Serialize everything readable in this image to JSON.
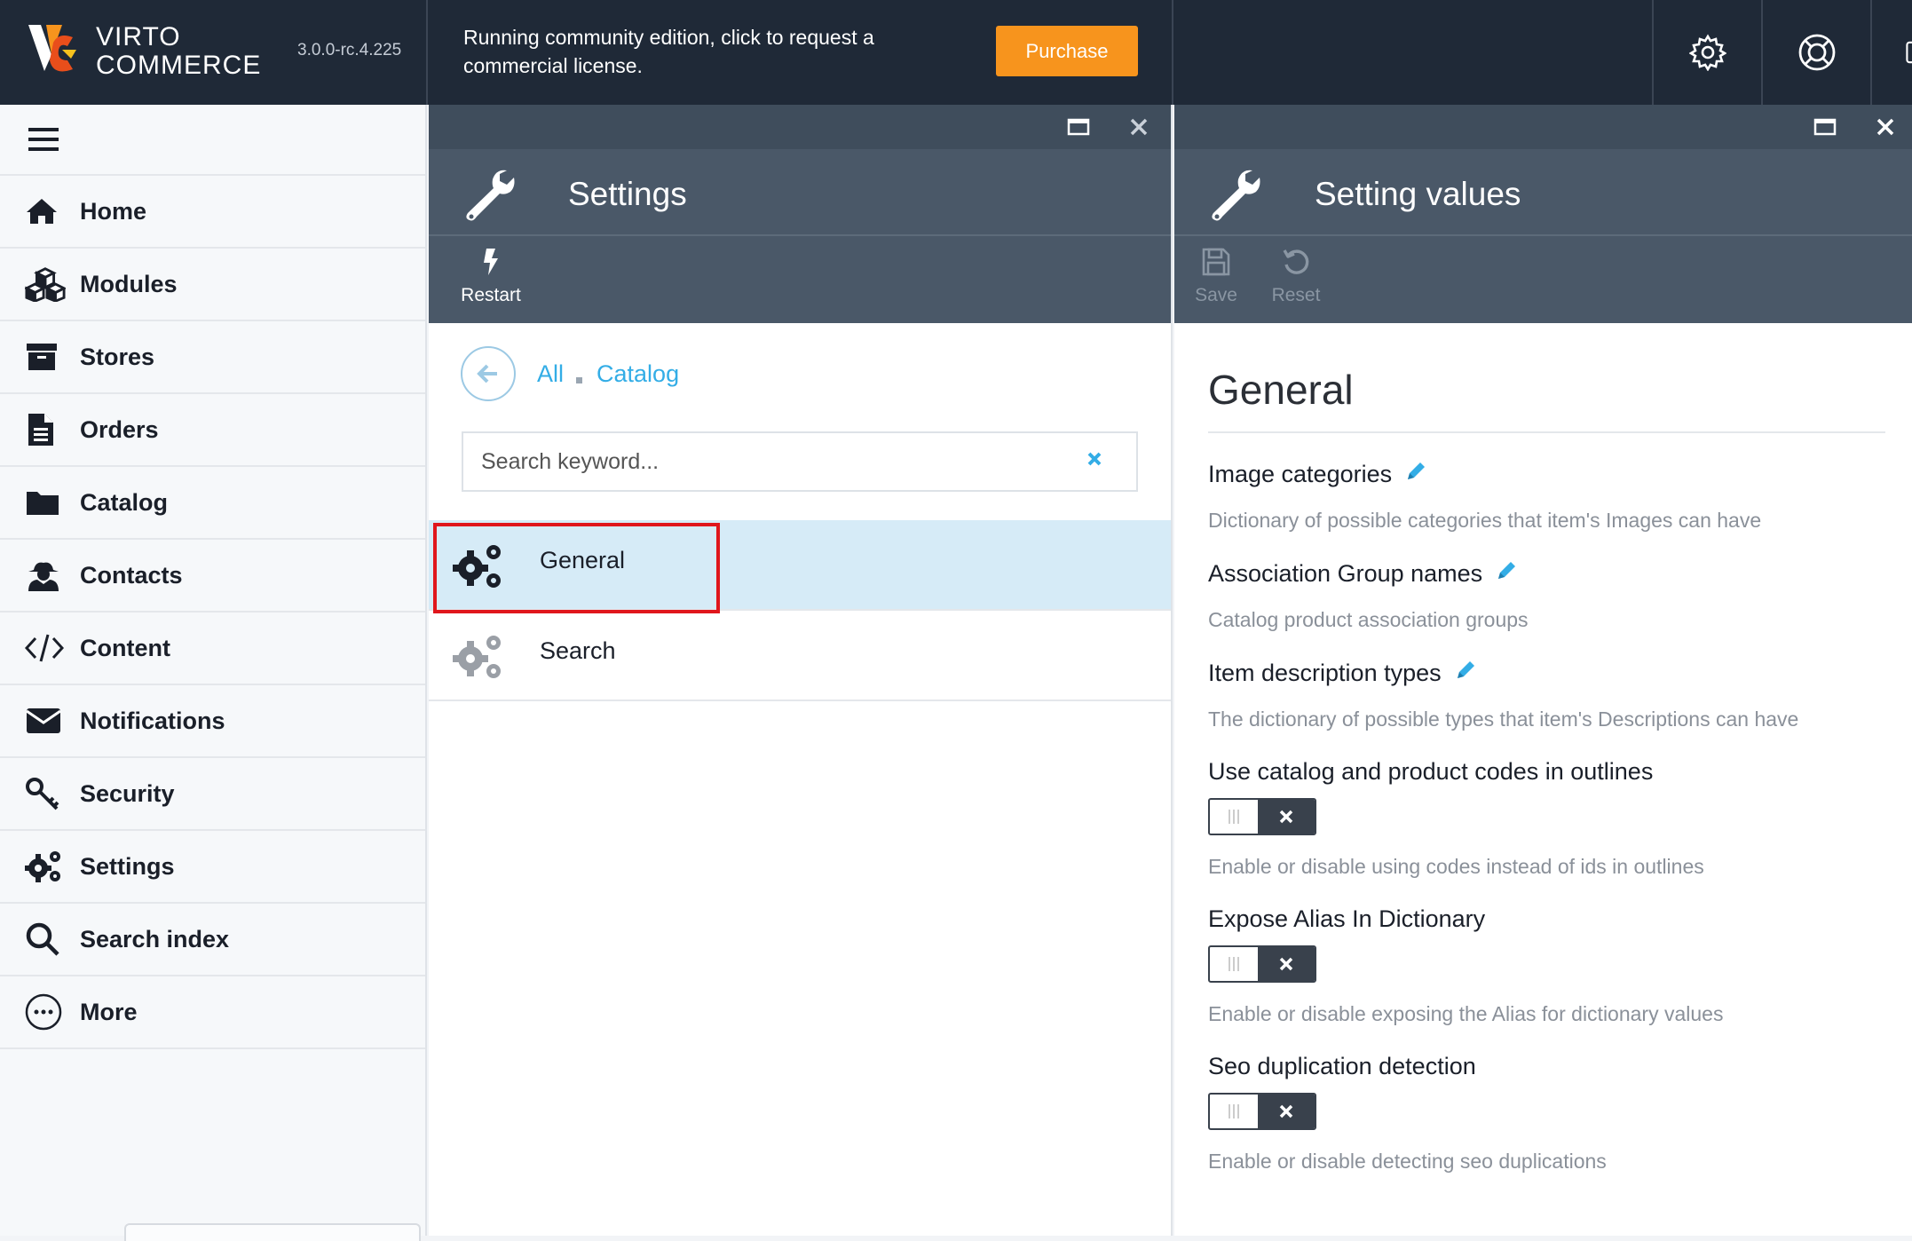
{
  "header": {
    "brand_line1": "VIRTO",
    "brand_line2": "COMMERCE",
    "version": "3.0.0-rc.4.225",
    "notice": "Running community edition, click to request a commercial license.",
    "purchase_label": "Purchase",
    "icons": [
      "gear-icon",
      "lifebuoy-icon",
      "user-icon"
    ],
    "accent_color": "#f7941d",
    "bg_color": "#1f2937"
  },
  "sidebar": {
    "items": [
      {
        "label": "Home",
        "icon": "home-icon"
      },
      {
        "label": "Modules",
        "icon": "cubes-icon"
      },
      {
        "label": "Stores",
        "icon": "archive-icon"
      },
      {
        "label": "Orders",
        "icon": "document-icon"
      },
      {
        "label": "Catalog",
        "icon": "folder-icon"
      },
      {
        "label": "Contacts",
        "icon": "user-secret-icon"
      },
      {
        "label": "Content",
        "icon": "code-icon"
      },
      {
        "label": "Notifications",
        "icon": "envelope-icon"
      },
      {
        "label": "Security",
        "icon": "key-icon"
      },
      {
        "label": "Settings",
        "icon": "gears-icon"
      },
      {
        "label": "Search index",
        "icon": "search-icon"
      },
      {
        "label": "More",
        "icon": "ellipsis-circle-icon"
      }
    ]
  },
  "blade1": {
    "title": "Settings",
    "toolbar": {
      "restart_label": "Restart"
    },
    "breadcrumbs": [
      "All",
      "Catalog"
    ],
    "search": {
      "placeholder": "Search keyword...",
      "value": ""
    },
    "items": [
      {
        "label": "General",
        "selected": true
      },
      {
        "label": "Search",
        "selected": false
      }
    ]
  },
  "blade2": {
    "title": "Setting values",
    "toolbar": {
      "save_label": "Save",
      "reset_label": "Reset"
    },
    "section_title": "General",
    "fields": [
      {
        "label": "Image categories",
        "type": "dictionary",
        "description": "Dictionary of possible categories that item's Images can have"
      },
      {
        "label": "Association Group names",
        "type": "dictionary",
        "description": "Catalog product association groups"
      },
      {
        "label": "Item description types",
        "type": "dictionary",
        "description": "The dictionary of possible types that item's Descriptions can have"
      },
      {
        "label": "Use catalog and product codes in outlines",
        "type": "toggle",
        "value": false,
        "description": "Enable or disable using codes instead of ids in outlines"
      },
      {
        "label": "Expose Alias In Dictionary",
        "type": "toggle",
        "value": false,
        "description": "Enable or disable exposing the Alias for dictionary values"
      },
      {
        "label": "Seo duplication detection",
        "type": "toggle",
        "value": false,
        "description": "Enable or disable detecting seo duplications"
      }
    ]
  }
}
